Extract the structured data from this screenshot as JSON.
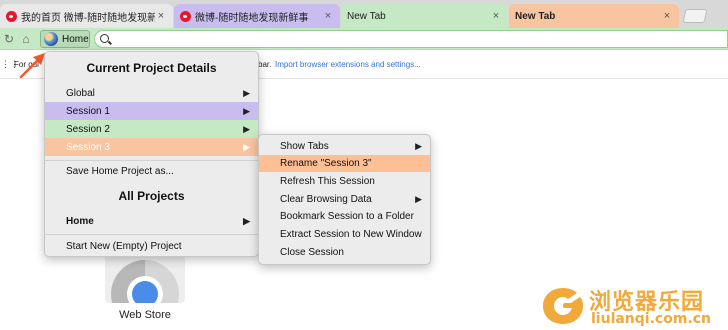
{
  "tabs": [
    {
      "title": "我的首页 微博-随时随地发现新鲜事",
      "close": "×"
    },
    {
      "title": "微博-随时随地发现新鲜事",
      "close": "×"
    },
    {
      "title": "New Tab",
      "close": "×"
    },
    {
      "title": "New Tab",
      "close": "×"
    }
  ],
  "toolbar": {
    "reload_icon": "↻",
    "home_icon": "⌂",
    "home_label": "Home",
    "omnibox_value": ""
  },
  "bookmarks": {
    "apps_icon": "⋮⋮",
    "quick_text": "For qui",
    "bar_text": "bar.",
    "import_link": "Import browser extensions and settings..."
  },
  "project_menu": {
    "header": "Current Project Details",
    "items": [
      {
        "label": "Global",
        "arrow": "▶"
      },
      {
        "label": "Session 1",
        "arrow": "▶"
      },
      {
        "label": "Session 2",
        "arrow": "▶"
      },
      {
        "label": "Session 3",
        "arrow": "▶"
      }
    ],
    "save_label": "Save Home Project as...",
    "all_header": "All Projects",
    "home_item": {
      "label": "Home",
      "arrow": "▶"
    },
    "new_project": "Start New (Empty) Project"
  },
  "session_menu": {
    "items": [
      {
        "label": "Show Tabs",
        "arrow": "▶"
      },
      {
        "label": "Rename \"Session 3\"",
        "arrow": ""
      },
      {
        "label": "Refresh This Session",
        "arrow": ""
      },
      {
        "label": "Clear Browsing Data",
        "arrow": "▶"
      },
      {
        "label": "Bookmark Session to a Folder",
        "arrow": ""
      },
      {
        "label": "Extract Session to New Window",
        "arrow": ""
      },
      {
        "label": "Close Session",
        "arrow": ""
      }
    ]
  },
  "webstore": {
    "label": "Web Store"
  },
  "watermark": {
    "name": "浏览器乐园",
    "url": "liulanqi.com.cn"
  },
  "colors": {
    "session1": "#c9bdf0",
    "session2": "#c5e9c4",
    "session3": "#f8c5a0",
    "rename_highlight": "#fdbf94",
    "arrow": "#ef5a2f",
    "watermark": "#f2a93b"
  }
}
